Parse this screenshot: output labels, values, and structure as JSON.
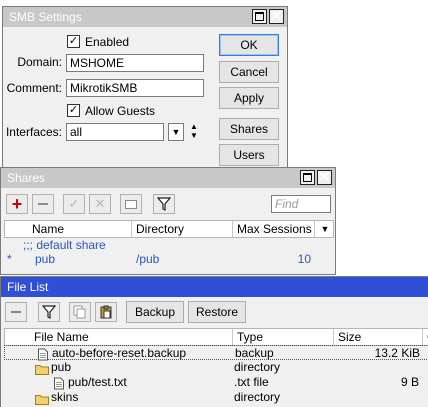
{
  "smb": {
    "title": "SMB Settings",
    "enabled_label": "Enabled",
    "domain_label": "Domain:",
    "domain_value": "MSHOME",
    "comment_label": "Comment:",
    "comment_value": "MikrotikSMB",
    "allow_guests_label": "Allow Guests",
    "interfaces_label": "Interfaces:",
    "interfaces_value": "all",
    "buttons": {
      "ok": "OK",
      "cancel": "Cancel",
      "apply": "Apply",
      "shares": "Shares",
      "users": "Users"
    }
  },
  "shares": {
    "title": "Shares",
    "find_placeholder": "Find",
    "columns": [
      "Name",
      "Directory",
      "Max Sessions"
    ],
    "comment_row": ";;; default share",
    "rows": [
      {
        "flag": "*",
        "name": "pub",
        "directory": "/pub",
        "max_sessions": "10"
      }
    ]
  },
  "filelist": {
    "title": "File List",
    "backup_label": "Backup",
    "restore_label": "Restore",
    "columns": [
      "File Name",
      "Type",
      "Size",
      "C"
    ],
    "rows": [
      {
        "name": "auto-before-reset.backup",
        "type": "backup",
        "size": "13.2 KiB",
        "icon": "file-icon"
      },
      {
        "name": "pub",
        "type": "directory",
        "size": "",
        "icon": "folder-icon"
      },
      {
        "name": "pub/test.txt",
        "type": ".txt file",
        "size": "9 B",
        "icon": "file-icon"
      },
      {
        "name": "skins",
        "type": "directory",
        "size": "",
        "icon": "folder-icon"
      }
    ]
  },
  "colors": {
    "active_title": "#2f4fd6",
    "inactive_title": "#c8c8c8",
    "link_text": "#2a55c9",
    "add_red": "#d40000"
  }
}
